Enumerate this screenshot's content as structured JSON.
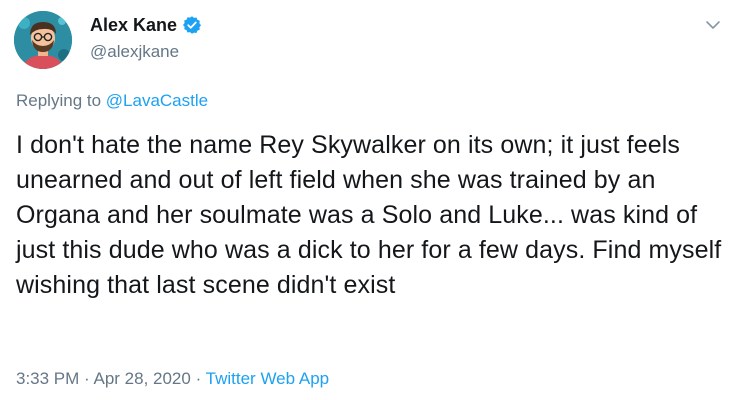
{
  "author": {
    "display_name": "Alex Kane",
    "handle": "@alexjkane",
    "avatar_icon": "avatar-illustrated-man",
    "verified_icon": "verified-badge-icon"
  },
  "reply": {
    "prefix": "Replying to ",
    "mention": "@LavaCastle"
  },
  "tweet": {
    "text": "I don't hate the name Rey Skywalker on its own; it just feels unearned and out of left field when she was trained by an Organa and her soulmate was a Solo and Luke... was kind of just this dude who was a dick to her for a few days. Find myself wishing that last scene didn't exist"
  },
  "meta": {
    "time": "3:33 PM",
    "separator": " · ",
    "date": "Apr 28, 2020",
    "source": "Twitter Web App"
  },
  "colors": {
    "accent": "#1da1f2",
    "secondary_text": "#657786",
    "primary_text": "#14171a"
  },
  "menu_icon": "chevron-down-icon"
}
